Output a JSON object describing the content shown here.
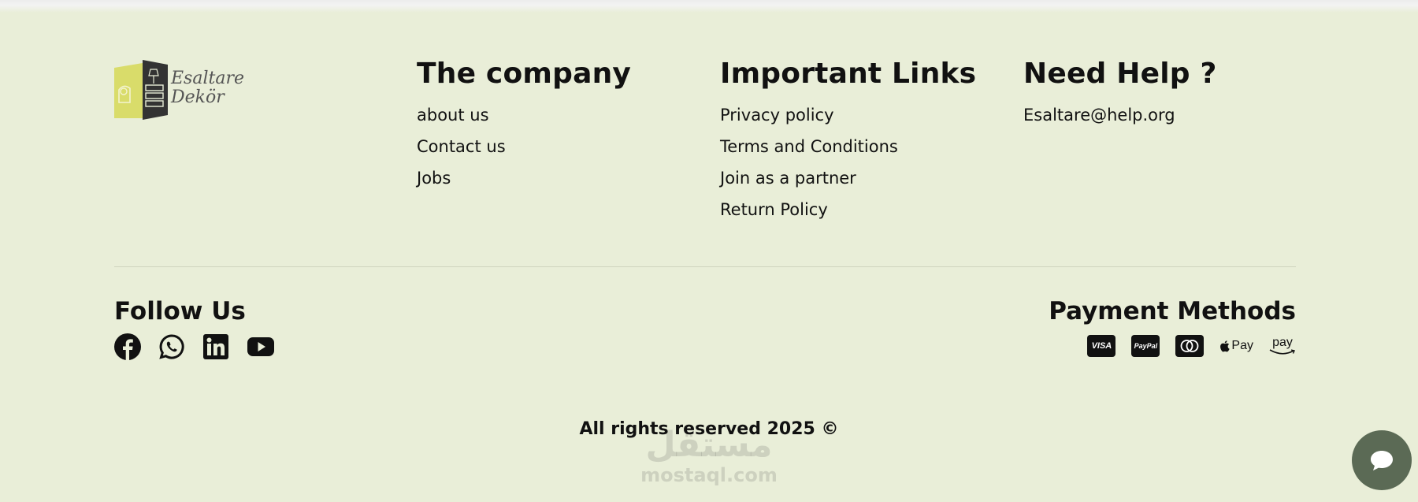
{
  "brand": {
    "logo_line1": "Esaltare",
    "logo_line2": "Dekör"
  },
  "company": {
    "title": "The company",
    "links": [
      "about us",
      "Contact us",
      "Jobs"
    ]
  },
  "important_links": {
    "title": "Important Links",
    "links": [
      "Privacy policy",
      "Terms and Conditions",
      "Join as a partner",
      "Return Policy"
    ]
  },
  "help": {
    "title": "Need Help ?",
    "email": "Esaltare@help.org"
  },
  "follow": {
    "title": "Follow Us",
    "icons": [
      "facebook-icon",
      "whatsapp-icon",
      "linkedin-icon",
      "youtube-icon"
    ]
  },
  "payment": {
    "title": "Payment Methods",
    "visa_label": "VISA",
    "paypal_label": "PayPal",
    "applepay_label": "Pay",
    "amazonpay_label": "pay",
    "icons": [
      "visa-icon",
      "paypal-icon",
      "mastercard-icon",
      "apple-pay-icon",
      "amazon-pay-icon"
    ]
  },
  "copyright": "All rights reserved 2025 ©",
  "watermark": {
    "arabic": "مستقل",
    "latin": "mostaql.com"
  },
  "colors": {
    "background": "#e9eed8",
    "logo_yellow": "#d9dc6a",
    "logo_dark": "#333333",
    "chat_button": "#5b6a55",
    "text": "#111111"
  }
}
